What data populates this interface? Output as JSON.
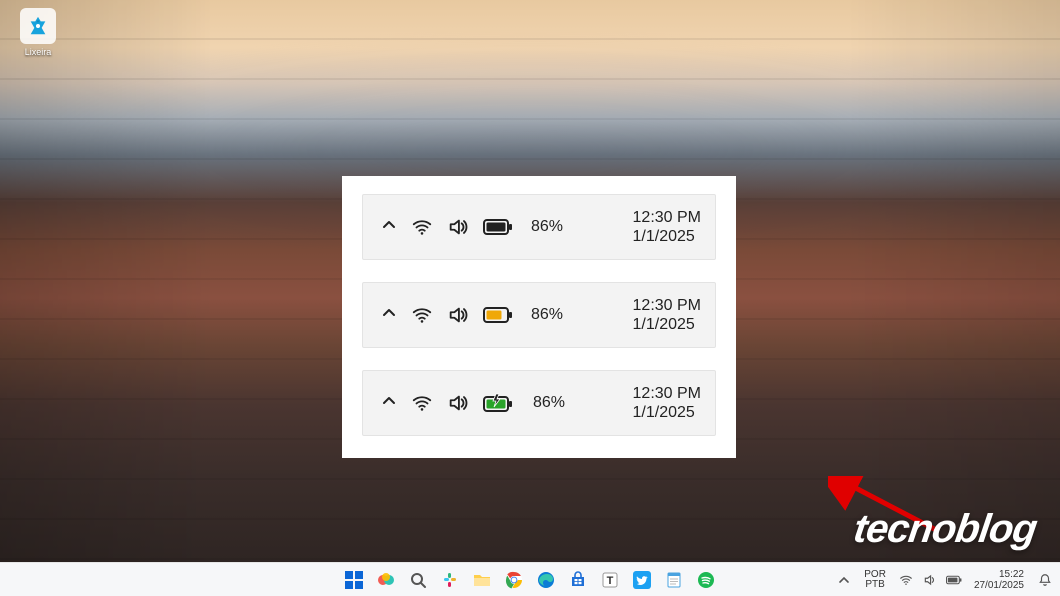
{
  "desktop": {
    "recycle_bin_label": "Lixeira"
  },
  "overlay": {
    "examples": [
      {
        "battery_percent": "86%",
        "time": "12:30 PM",
        "date": "1/1/2025",
        "battery_state": "full-black"
      },
      {
        "battery_percent": "86%",
        "time": "12:30 PM",
        "date": "1/1/2025",
        "battery_state": "medium-orange"
      },
      {
        "battery_percent": "86%",
        "time": "12:30 PM",
        "date": "1/1/2025",
        "battery_state": "charging-green"
      }
    ]
  },
  "watermark": {
    "text": "tecnoblog"
  },
  "taskbar": {
    "apps": [
      "start",
      "copilot",
      "search",
      "slack",
      "explorer",
      "chrome",
      "edge",
      "store",
      "text",
      "twitter",
      "notepad",
      "spotify"
    ],
    "language_top": "POR",
    "language_bottom": "PTB",
    "time": "15:22",
    "date": "27/01/2025"
  }
}
